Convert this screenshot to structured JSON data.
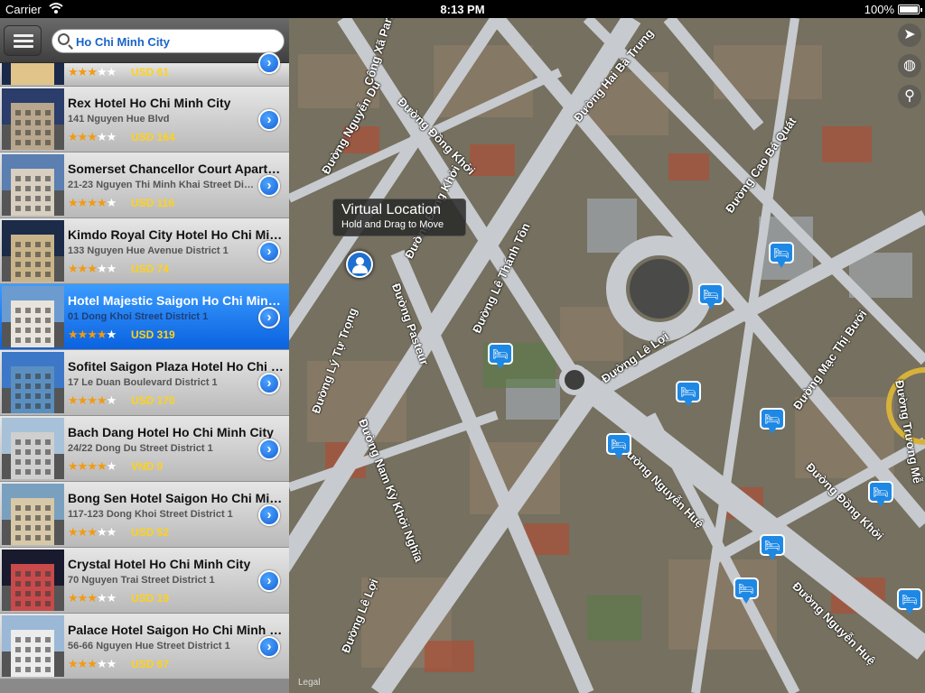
{
  "status_bar": {
    "carrier": "Carrier",
    "time": "8:13 PM",
    "battery": "100%"
  },
  "search": {
    "value": "Ho Chi Minh City"
  },
  "hotels": [
    {
      "name": "",
      "address": "",
      "stars": 3,
      "price": "USD 61",
      "selected": false,
      "partial": true
    },
    {
      "name": "Rex Hotel Ho Chi Minh City",
      "address": "141 Nguyen Hue Blvd",
      "stars": 3,
      "price": "USD 164",
      "selected": false
    },
    {
      "name": "Somerset Chancellor Court Apartments",
      "address": "21-23 Nguyen Thi Minh Khai Street District 1",
      "stars": 4,
      "price": "USD 116",
      "selected": false
    },
    {
      "name": "Kimdo Royal City Hotel Ho Chi Minh City",
      "address": "133 Nguyen Hue Avenue District 1",
      "stars": 3,
      "price": "USD 74",
      "selected": false
    },
    {
      "name": "Hotel Majestic Saigon Ho Chi Minh City",
      "address": "01 Dong Khoi Street District 1",
      "stars": 4,
      "price": "USD 319",
      "selected": true
    },
    {
      "name": "Sofitel Saigon Plaza Hotel Ho Chi Minh City",
      "address": "17 Le Duan Boulevard District 1",
      "stars": 4,
      "price": "USD 170",
      "selected": false
    },
    {
      "name": "Bach Dang Hotel Ho Chi Minh City",
      "address": "24/22 Dong Du Street District 1",
      "stars": 4,
      "price": "VND 0",
      "selected": false
    },
    {
      "name": "Bong Sen Hotel Saigon Ho Chi Minh City",
      "address": "117-123 Dong Khoi Street District 1",
      "stars": 3,
      "price": "USD 52",
      "selected": false
    },
    {
      "name": "Crystal Hotel Ho Chi Minh City",
      "address": "70 Nguyen Trai Street District 1",
      "stars": 3,
      "price": "USD 19",
      "selected": false
    },
    {
      "name": "Palace Hotel Saigon Ho Chi Minh City",
      "address": "56-66 Nguyen Hue Street District 1",
      "stars": 3,
      "price": "USD 67",
      "selected": false
    }
  ],
  "map": {
    "callout_title": "Virtual Location",
    "callout_subtitle": "Hold and Drag to Move",
    "legal": "Legal",
    "streets": [
      "Đường Hai Bà Trưng",
      "Công Xã Paris",
      "Đường Nguyễn Du",
      "Đường Đồng Khởi",
      "Đường Cao Bá Quát",
      "Đường Đồng Khởi",
      "Đường Pasteur",
      "Đường Lê Thánh Tôn",
      "Đường Lê Lợi",
      "Đường Lý Tự Trọng",
      "Đường Mạc Thị Bưởi",
      "Đường Nam Kỳ Khởi Nghĩa",
      "Đường Nguyễn Huệ",
      "Đường Đồng Khởi",
      "Đường Lê Lợi",
      "Đường Nguyễn Huệ",
      "Đường Trương Mễ"
    ]
  },
  "colors": {
    "selected_row": "#1a7ff0",
    "star": "#f39a10",
    "price": "#ffd21a",
    "search_text": "#1a64c8",
    "pin": "#1e88e5"
  }
}
